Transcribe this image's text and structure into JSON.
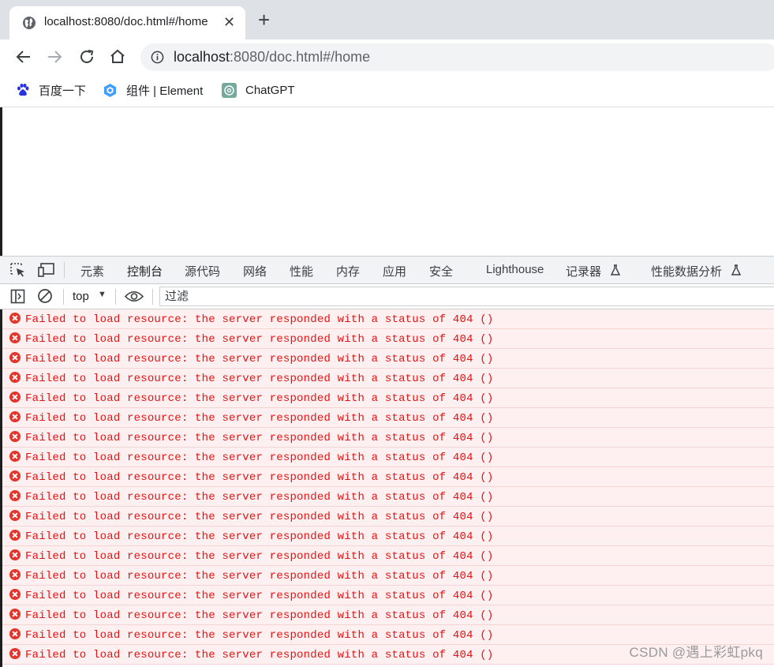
{
  "browser": {
    "tab": {
      "title": "localhost:8080/doc.html#/home",
      "icon": "globe-icon"
    },
    "new_tab_symbol": "+",
    "close_symbol": "✕",
    "address": {
      "host": "localhost",
      "rest": ":8080/doc.html#/home"
    },
    "bookmarks": [
      {
        "label": "百度一下",
        "icon": "baidu-paw-icon"
      },
      {
        "label": "组件 | Element",
        "icon": "element-hexagon-icon"
      },
      {
        "label": "ChatGPT",
        "icon": "openai-icon"
      }
    ]
  },
  "devtools": {
    "tabs": [
      "元素",
      "控制台",
      "源代码",
      "网络",
      "性能",
      "内存",
      "应用",
      "安全",
      "Lighthouse",
      "记录器",
      "性能数据分析"
    ],
    "active_tab": "控制台",
    "context": "top",
    "filter_placeholder": "过滤",
    "messages": [
      "Failed to load resource: the server responded with a status of 404 ()",
      "Failed to load resource: the server responded with a status of 404 ()",
      "Failed to load resource: the server responded with a status of 404 ()",
      "Failed to load resource: the server responded with a status of 404 ()",
      "Failed to load resource: the server responded with a status of 404 ()",
      "Failed to load resource: the server responded with a status of 404 ()",
      "Failed to load resource: the server responded with a status of 404 ()",
      "Failed to load resource: the server responded with a status of 404 ()",
      "Failed to load resource: the server responded with a status of 404 ()",
      "Failed to load resource: the server responded with a status of 404 ()",
      "Failed to load resource: the server responded with a status of 404 ()",
      "Failed to load resource: the server responded with a status of 404 ()",
      "Failed to load resource: the server responded with a status of 404 ()",
      "Failed to load resource: the server responded with a status of 404 ()",
      "Failed to load resource: the server responded with a status of 404 ()",
      "Failed to load resource: the server responded with a status of 404 ()",
      "Failed to load resource: the server responded with a status of 404 ()",
      "Failed to load resource: the server responded with a status of 404 ()"
    ]
  },
  "watermark": "CSDN @遇上彩虹pkq",
  "colors": {
    "accent": "#1a73e8",
    "error_text": "#e31414",
    "error_bg": "#fef0f0",
    "error_icon": "#e3352b"
  }
}
